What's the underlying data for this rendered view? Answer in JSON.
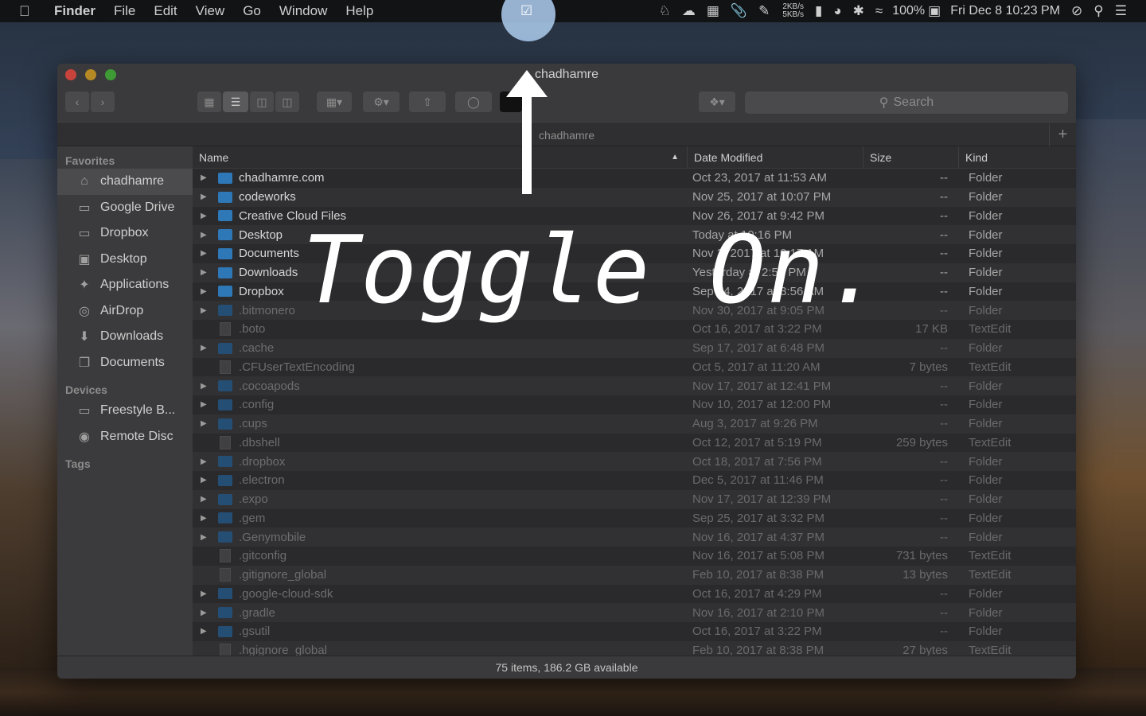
{
  "menubar": {
    "app_name": "Finder",
    "menus": [
      "File",
      "Edit",
      "View",
      "Go",
      "Window",
      "Help"
    ],
    "net_up": "2KB/s",
    "net_down": "5KB/s",
    "battery": "100%",
    "clock": "Fri Dec 8  10:23 PM"
  },
  "window": {
    "title": "chadhamre",
    "path_title": "chadhamre",
    "search_placeholder": "Search",
    "status": "75 items, 186.2 GB available"
  },
  "sidebar": {
    "favorites_heading": "Favorites",
    "favorites": [
      {
        "label": "chadhamre",
        "icon": "home-icon"
      },
      {
        "label": "Google Drive",
        "icon": "folder-icon"
      },
      {
        "label": "Dropbox",
        "icon": "folder-icon"
      },
      {
        "label": "Desktop",
        "icon": "desktop-icon"
      },
      {
        "label": "Applications",
        "icon": "applications-icon"
      },
      {
        "label": "AirDrop",
        "icon": "airdrop-icon"
      },
      {
        "label": "Downloads",
        "icon": "downloads-icon"
      },
      {
        "label": "Documents",
        "icon": "documents-icon"
      }
    ],
    "devices_heading": "Devices",
    "devices": [
      {
        "label": "Freestyle B...",
        "icon": "laptop-icon"
      },
      {
        "label": "Remote Disc",
        "icon": "disc-icon"
      }
    ],
    "tags_heading": "Tags"
  },
  "columns": {
    "name": "Name",
    "date": "Date Modified",
    "size": "Size",
    "kind": "Kind"
  },
  "files": [
    {
      "name": "chadhamre.com",
      "date": "Oct 23, 2017 at 11:53 AM",
      "size": "--",
      "kind": "Folder",
      "type": "folder",
      "hidden": false
    },
    {
      "name": "codeworks",
      "date": "Nov 25, 2017 at 10:07 PM",
      "size": "--",
      "kind": "Folder",
      "type": "folder",
      "hidden": false
    },
    {
      "name": "Creative Cloud Files",
      "date": "Nov 26, 2017 at 9:42 PM",
      "size": "--",
      "kind": "Folder",
      "type": "folder",
      "hidden": false
    },
    {
      "name": "Desktop",
      "date": "Today at 10:16 PM",
      "size": "--",
      "kind": "Folder",
      "type": "folder",
      "hidden": false
    },
    {
      "name": "Documents",
      "date": "Nov 3, 2017 at 10:17 AM",
      "size": "--",
      "kind": "Folder",
      "type": "folder",
      "hidden": false
    },
    {
      "name": "Downloads",
      "date": "Yesterday at 2:54 PM",
      "size": "--",
      "kind": "Folder",
      "type": "folder",
      "hidden": false
    },
    {
      "name": "Dropbox",
      "date": "Sep 14, 2017 at 3:56 AM",
      "size": "--",
      "kind": "Folder",
      "type": "folder",
      "hidden": false
    },
    {
      "name": ".bitmonero",
      "date": "Nov 30, 2017 at 9:05 PM",
      "size": "--",
      "kind": "Folder",
      "type": "folder",
      "hidden": true
    },
    {
      "name": ".boto",
      "date": "Oct 16, 2017 at 3:22 PM",
      "size": "17 KB",
      "kind": "TextEdit",
      "type": "doc",
      "hidden": true
    },
    {
      "name": ".cache",
      "date": "Sep 17, 2017 at 6:48 PM",
      "size": "--",
      "kind": "Folder",
      "type": "folder",
      "hidden": true
    },
    {
      "name": ".CFUserTextEncoding",
      "date": "Oct 5, 2017 at 11:20 AM",
      "size": "7 bytes",
      "kind": "TextEdit",
      "type": "doc",
      "hidden": true
    },
    {
      "name": ".cocoapods",
      "date": "Nov 17, 2017 at 12:41 PM",
      "size": "--",
      "kind": "Folder",
      "type": "folder",
      "hidden": true
    },
    {
      "name": ".config",
      "date": "Nov 10, 2017 at 12:00 PM",
      "size": "--",
      "kind": "Folder",
      "type": "folder",
      "hidden": true
    },
    {
      "name": ".cups",
      "date": "Aug 3, 2017 at 9:26 PM",
      "size": "--",
      "kind": "Folder",
      "type": "folder",
      "hidden": true
    },
    {
      "name": ".dbshell",
      "date": "Oct 12, 2017 at 5:19 PM",
      "size": "259 bytes",
      "kind": "TextEdit",
      "type": "doc",
      "hidden": true
    },
    {
      "name": ".dropbox",
      "date": "Oct 18, 2017 at 7:56 PM",
      "size": "--",
      "kind": "Folder",
      "type": "folder",
      "hidden": true
    },
    {
      "name": ".electron",
      "date": "Dec 5, 2017 at 11:46 PM",
      "size": "--",
      "kind": "Folder",
      "type": "folder",
      "hidden": true
    },
    {
      "name": ".expo",
      "date": "Nov 17, 2017 at 12:39 PM",
      "size": "--",
      "kind": "Folder",
      "type": "folder",
      "hidden": true
    },
    {
      "name": ".gem",
      "date": "Sep 25, 2017 at 3:32 PM",
      "size": "--",
      "kind": "Folder",
      "type": "folder",
      "hidden": true
    },
    {
      "name": ".Genymobile",
      "date": "Nov 16, 2017 at 4:37 PM",
      "size": "--",
      "kind": "Folder",
      "type": "folder",
      "hidden": true
    },
    {
      "name": ".gitconfig",
      "date": "Nov 16, 2017 at 5:08 PM",
      "size": "731 bytes",
      "kind": "TextEdit",
      "type": "doc",
      "hidden": true
    },
    {
      "name": ".gitignore_global",
      "date": "Feb 10, 2017 at 8:38 PM",
      "size": "13 bytes",
      "kind": "TextEdit",
      "type": "doc",
      "hidden": true
    },
    {
      "name": ".google-cloud-sdk",
      "date": "Oct 16, 2017 at 4:29 PM",
      "size": "--",
      "kind": "Folder",
      "type": "folder",
      "hidden": true
    },
    {
      "name": ".gradle",
      "date": "Nov 16, 2017 at 2:10 PM",
      "size": "--",
      "kind": "Folder",
      "type": "folder",
      "hidden": true
    },
    {
      "name": ".gsutil",
      "date": "Oct 16, 2017 at 3:22 PM",
      "size": "--",
      "kind": "Folder",
      "type": "folder",
      "hidden": true
    },
    {
      "name": ".hgignore_global",
      "date": "Feb 10, 2017 at 8:38 PM",
      "size": "27 bytes",
      "kind": "TextEdit",
      "type": "doc",
      "hidden": true
    }
  ],
  "overlay": {
    "caption": "Toggle On."
  }
}
